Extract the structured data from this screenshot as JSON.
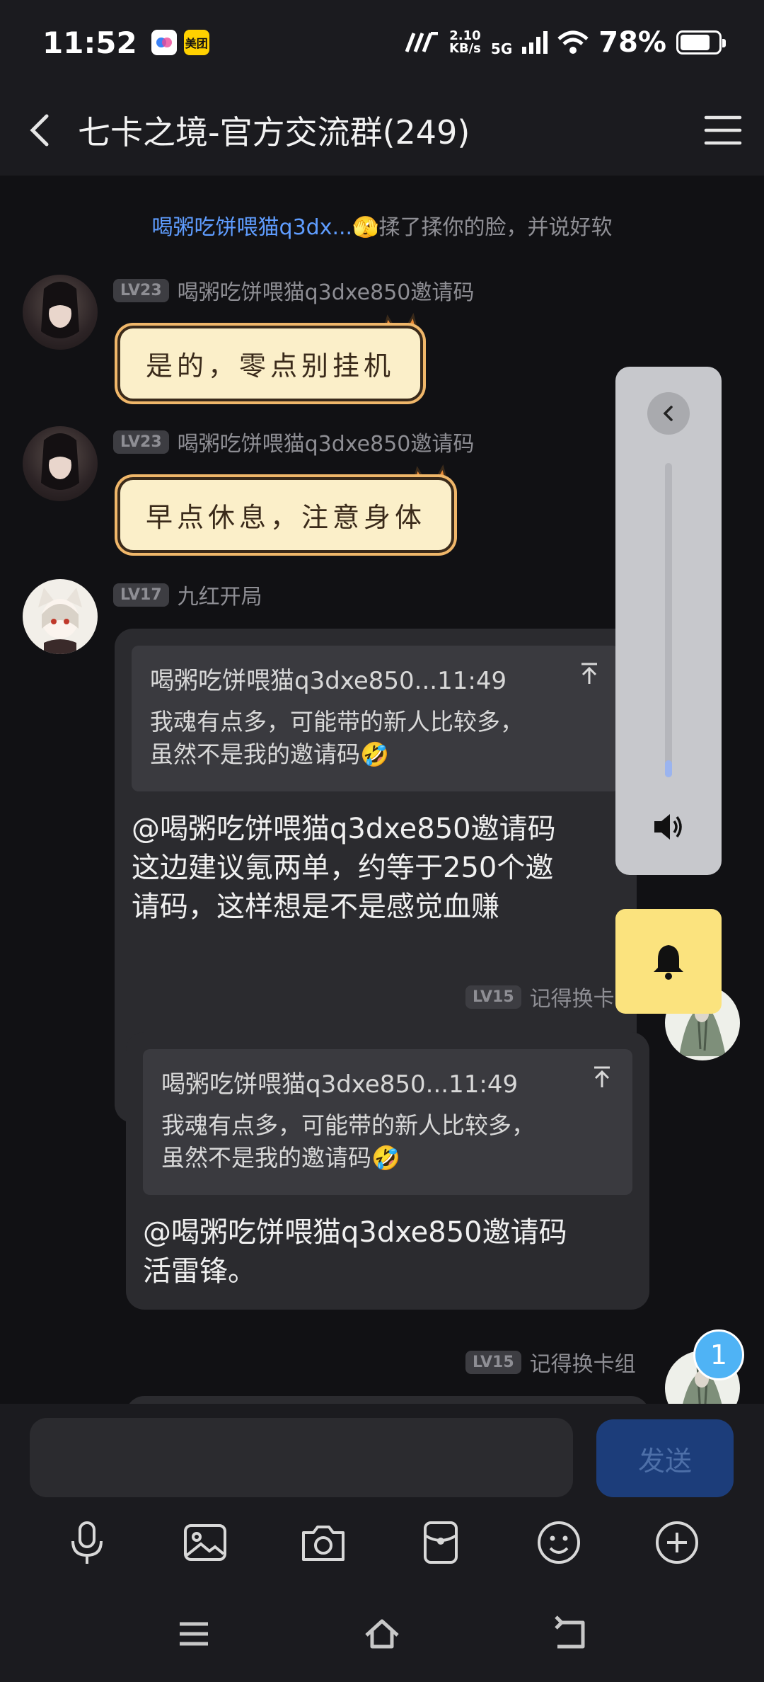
{
  "status_bar": {
    "time": "11:52",
    "app_icon_1": "app-icon",
    "app_icon_2_label": "美团",
    "net_speed_top": "2.10",
    "net_speed_bottom": "KB/s",
    "network": "5G",
    "battery": "78%"
  },
  "header": {
    "title": "七卡之境-官方交流群(249)"
  },
  "system_message": {
    "who": "喝粥吃饼喂猫q3dx...",
    "emoji": "🫣",
    "action": "揉了揉你的脸，并说好软"
  },
  "messages": [
    {
      "level": "LV23",
      "name": "喝粥吃饼喂猫q3dxe850邀请码",
      "text": "是的，零点别挂机"
    },
    {
      "level": "LV23",
      "name": "喝粥吃饼喂猫q3dxe850邀请码",
      "text": "早点休息，注意身体"
    },
    {
      "level": "LV17",
      "name": "九红开局",
      "quote_head": "喝粥吃饼喂猫q3dxe850...11:49",
      "quote_line1": "我魂有点多，可能带的新人比较多，",
      "quote_line2": "虽然不是我的邀请码🤣",
      "text_line1": "@喝粥吃饼喂猫q3dxe850邀请码",
      "text_line2": "这边建议氪两单，约等于250个邀",
      "text_line3": "请码，这样想是不是感觉血赚"
    },
    {
      "level": "LV15",
      "name": "记得换卡",
      "quote_head": "喝粥吃饼喂猫q3dxe850...11:49",
      "quote_line1": "我魂有点多，可能带的新人比较多，",
      "quote_line2": "虽然不是我的邀请码🤣",
      "text_line1": "@喝粥吃饼喂猫q3dxe850邀请码",
      "text_line2": "活雷锋。"
    },
    {
      "level": "LV15",
      "name": "记得换卡组"
    }
  ],
  "volume_panel": {
    "level": 0.04
  },
  "unread_badge": "1",
  "input": {
    "send_label": "发送"
  },
  "colors": {
    "background": "#111114",
    "bar": "#1b1b1f",
    "bubble": "#2b2b2f",
    "link": "#5f9dff",
    "send": "#1c3d7a",
    "bell": "#fbe37e",
    "badge": "#4fb3f5"
  }
}
